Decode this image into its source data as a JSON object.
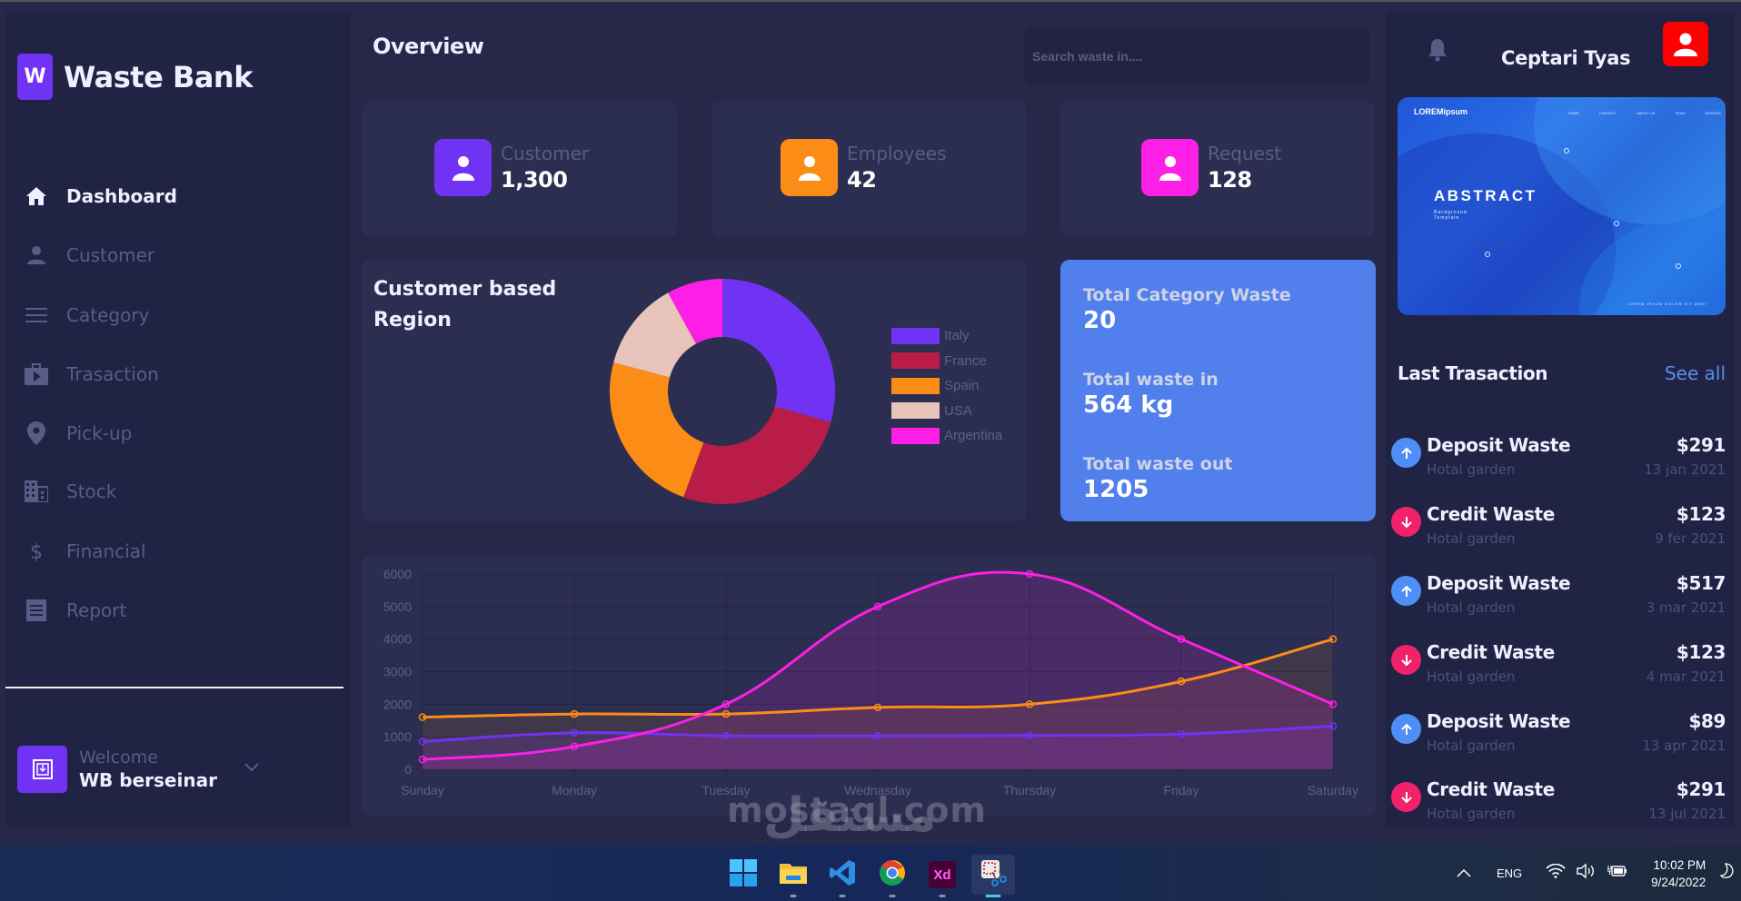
{
  "app": {
    "logo_letter": "W",
    "title": "Waste Bank"
  },
  "sidebar": {
    "items": [
      {
        "label": "Dashboard",
        "icon": "home-icon",
        "active": true
      },
      {
        "label": "Customer",
        "icon": "person-icon",
        "active": false
      },
      {
        "label": "Category",
        "icon": "menu-lines-icon",
        "active": false
      },
      {
        "label": "Trasaction",
        "icon": "briefcase-play-icon",
        "active": false
      },
      {
        "label": "Pick-up",
        "icon": "location-pin-icon",
        "active": false
      },
      {
        "label": "Stock",
        "icon": "building-icon",
        "active": false
      },
      {
        "label": "Financial",
        "icon": "dollar-icon",
        "active": false
      },
      {
        "label": "Report",
        "icon": "receipt-icon",
        "active": false
      }
    ],
    "welcome": {
      "greeting": "Welcome",
      "name": "WB berseinar"
    }
  },
  "header": {
    "title": "Overview",
    "search_placeholder": "Search waste in...."
  },
  "stats": [
    {
      "label": "Customer",
      "value": "1,300",
      "color": "#7133f3"
    },
    {
      "label": "Employees",
      "value": "42",
      "color": "#fb8d17"
    },
    {
      "label": "Request",
      "value": "128",
      "color": "#fd1fe6"
    }
  ],
  "waste_summary": [
    {
      "label": "Total Category Waste",
      "value": "20"
    },
    {
      "label": "Total waste in",
      "value": "564 kg"
    },
    {
      "label": "Total waste out",
      "value": "1205"
    }
  ],
  "right_panel": {
    "user_name": "Ceptari Tyas",
    "banner": {
      "brand": "LOREMipsum",
      "menu": [
        "HOME",
        "CONTACT",
        "ABOUT US",
        "TEAM",
        "SERVICE"
      ],
      "headline": "ABSTRACT",
      "subline": "Background Template",
      "footer": "LOREM IPSUM DOLOR SIT AMET"
    },
    "last_transaction_title": "Last Trasaction",
    "see_all": "See all",
    "transactions": [
      {
        "type": "deposit",
        "title": "Deposit Waste",
        "place": "Hotal garden",
        "amount": "$291",
        "date": "13 jan 2021"
      },
      {
        "type": "credit",
        "title": "Credit Waste",
        "place": "Hotal garden",
        "amount": "$123",
        "date": "9 fer 2021"
      },
      {
        "type": "deposit",
        "title": "Deposit Waste",
        "place": "Hotal garden",
        "amount": "$517",
        "date": "3 mar 2021"
      },
      {
        "type": "credit",
        "title": "Credit Waste",
        "place": "Hotal garden",
        "amount": "$123",
        "date": "4 mar 2021"
      },
      {
        "type": "deposit",
        "title": "Deposit Waste",
        "place": "Hotal garden",
        "amount": "$89",
        "date": "13 apr 2021"
      },
      {
        "type": "credit",
        "title": "Credit Waste",
        "place": "Hotal garden",
        "amount": "$291",
        "date": "13 jul 2021"
      }
    ],
    "colors": {
      "deposit": "#4f8ef5",
      "credit": "#f0226a"
    }
  },
  "watermark": {
    "latin": "mostaql.com",
    "arabic": "مستقل"
  },
  "taskbar": {
    "apps": [
      {
        "name": "start",
        "icon": "windows-icon"
      },
      {
        "name": "file-explorer",
        "icon": "folder-icon"
      },
      {
        "name": "vs-code",
        "icon": "vscode-icon"
      },
      {
        "name": "chrome",
        "icon": "chrome-icon"
      },
      {
        "name": "adobe-xd",
        "icon": "xd-icon",
        "label": "Xd"
      },
      {
        "name": "snipping-tool",
        "icon": "snipping-tool-icon",
        "active": true
      }
    ],
    "language": "ENG",
    "time": "10:02 PM",
    "date": "9/24/2022"
  },
  "chart_data": [
    {
      "type": "pie",
      "title": "Customer based Region",
      "categories": [
        "Italy",
        "France",
        "Spain",
        "USA",
        "Argentina"
      ],
      "values": [
        55,
        49,
        44,
        24,
        15
      ],
      "colors": [
        "#7133f3",
        "#b91d47",
        "#fb8d17",
        "#e8c3b9",
        "#fd1fe6"
      ],
      "donut": true,
      "legend": "right"
    },
    {
      "type": "area",
      "title": "",
      "xlabel": "",
      "ylabel": "",
      "categories": [
        "Sunday",
        "Monday",
        "Tuesday",
        "Wednasday",
        "Thursday",
        "Friday",
        "Saturday"
      ],
      "ylim": [
        0,
        6000
      ],
      "yticks": [
        0,
        1000,
        2000,
        3000,
        4000,
        5000,
        6000
      ],
      "grid": true,
      "legend": "none",
      "series": [
        {
          "name": "series-1",
          "color": "#7133f3",
          "values": [
            850,
            1120,
            1030,
            1030,
            1040,
            1080,
            1330
          ]
        },
        {
          "name": "series-2",
          "color": "#fb8d17",
          "values": [
            1600,
            1700,
            1700,
            1900,
            2000,
            2700,
            4000
          ]
        },
        {
          "name": "series-3",
          "color": "#fd1fe6",
          "values": [
            300,
            700,
            2000,
            5000,
            6000,
            4000,
            2000
          ]
        }
      ]
    }
  ]
}
